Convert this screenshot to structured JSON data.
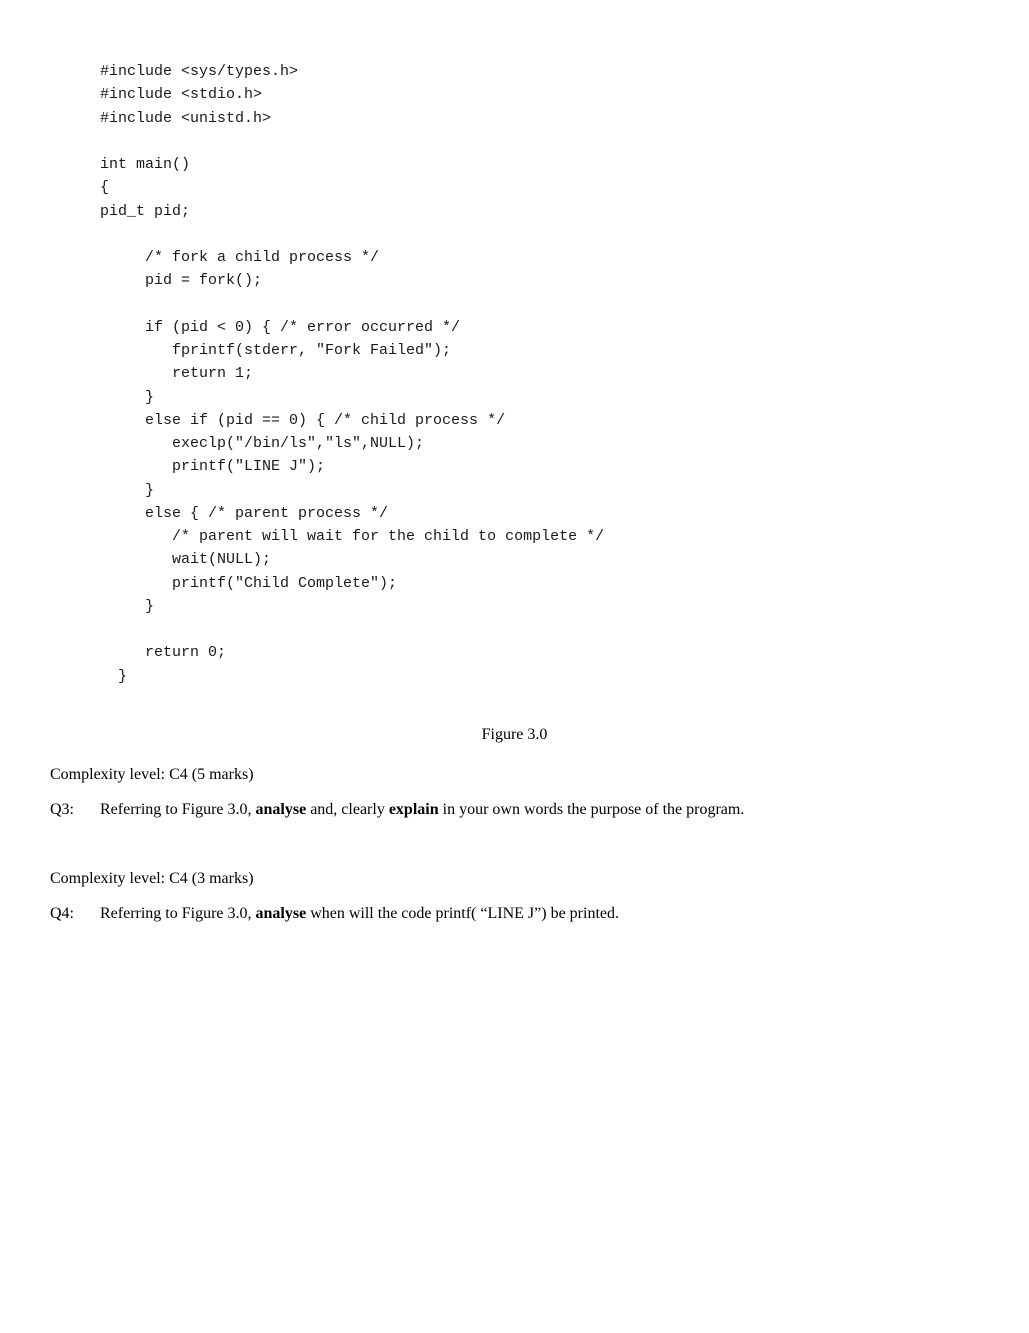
{
  "code": {
    "lines": [
      "#include <sys/types.h>",
      "#include <stdio.h>",
      "#include <unistd.h>",
      "",
      "int main()",
      "{",
      "pid_t pid;",
      "",
      "     /* fork a child process */",
      "     pid = fork();",
      "",
      "     if (pid < 0) { /* error occurred */",
      "        fprintf(stderr, \"Fork Failed\");",
      "        return 1;",
      "     }",
      "     else if (pid == 0) { /* child process */",
      "        execlp(\"/bin/ls\",\"ls\",NULL);",
      "        printf(\"LINE J\");",
      "     }",
      "     else { /* parent process */",
      "        /* parent will wait for the child to complete */",
      "        wait(NULL);",
      "        printf(\"Child Complete\");",
      "     }",
      "",
      "     return 0;",
      "  }"
    ]
  },
  "figure": {
    "caption": "Figure 3.0"
  },
  "q3": {
    "complexity": "Complexity level: C4 (5 marks)",
    "label": "Q3:",
    "text_before": "Referring to Figure 3.0, ",
    "bold1": "analyse",
    "text_middle": " and, clearly ",
    "bold2": "explain",
    "text_after": " in your own words the purpose of the program."
  },
  "q4": {
    "complexity": "Complexity level: C4 (3 marks)",
    "label": "Q4:",
    "text_before": "Referring to Figure 3.0, ",
    "bold1": "analyse",
    "text_after": " when will the code printf( “LINE J”) be printed."
  }
}
